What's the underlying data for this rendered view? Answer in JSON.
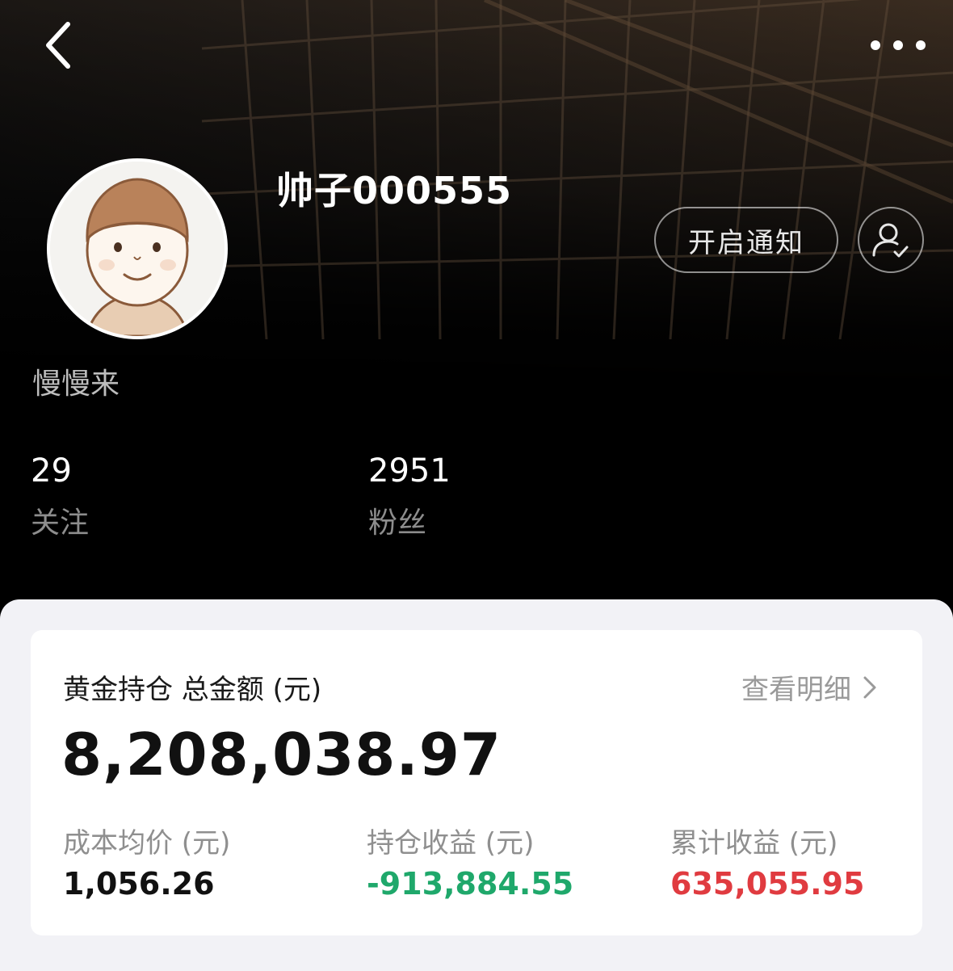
{
  "profile": {
    "username": "帅子000555",
    "bio": "慢慢来",
    "notify_label": "开启通知",
    "stats": [
      {
        "value": "29",
        "label": "关注"
      },
      {
        "value": "2951",
        "label": "粉丝"
      }
    ]
  },
  "icons": {
    "back": "chevron-left-icon",
    "more": "more-dots-icon",
    "follow": "user-check-icon"
  },
  "holding": {
    "title": "黄金持仓 总金额 (元)",
    "detail_label": "查看明细",
    "total": "8,208,038.97",
    "metrics": [
      {
        "label": "成本均价 (元)",
        "value": "1,056.26",
        "color": "#111111"
      },
      {
        "label": "持仓收益 (元)",
        "value": "-913,884.55",
        "color": "#1fa86b"
      },
      {
        "label": "累计收益 (元)",
        "value": "635,055.95",
        "color": "#e03b40"
      }
    ]
  }
}
